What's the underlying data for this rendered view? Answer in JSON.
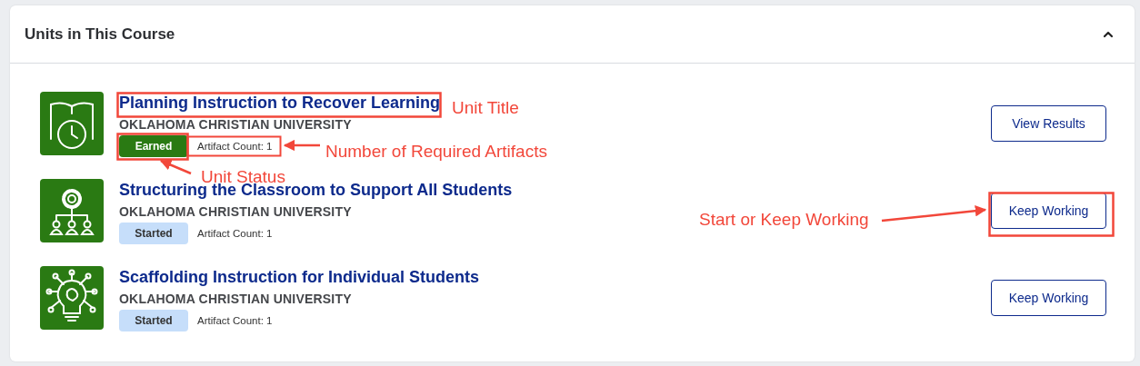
{
  "section": {
    "title": "Units in This Course",
    "expanded": true
  },
  "units": [
    {
      "title": "Planning Instruction to Recover Learning",
      "institution": "OKLAHOMA CHRISTIAN UNIVERSITY",
      "status": {
        "label": "Earned",
        "kind": "earned"
      },
      "artifact_count": "Artifact Count: 1",
      "button": "View Results"
    },
    {
      "title": "Structuring the Classroom to Support All Students",
      "institution": "OKLAHOMA CHRISTIAN UNIVERSITY",
      "status": {
        "label": "Started",
        "kind": "started"
      },
      "artifact_count": "Artifact Count: 1",
      "button": "Keep Working"
    },
    {
      "title": "Scaffolding Instruction for Individual Students",
      "institution": "OKLAHOMA CHRISTIAN UNIVERSITY",
      "status": {
        "label": "Started",
        "kind": "started"
      },
      "artifact_count": "Artifact Count: 1",
      "button": "Keep Working"
    }
  ],
  "annotations": [
    {
      "text": "Unit Title"
    },
    {
      "text": "Number of Required Artifacts"
    },
    {
      "text": "Unit Status"
    },
    {
      "text": "Start or Keep Working"
    }
  ]
}
